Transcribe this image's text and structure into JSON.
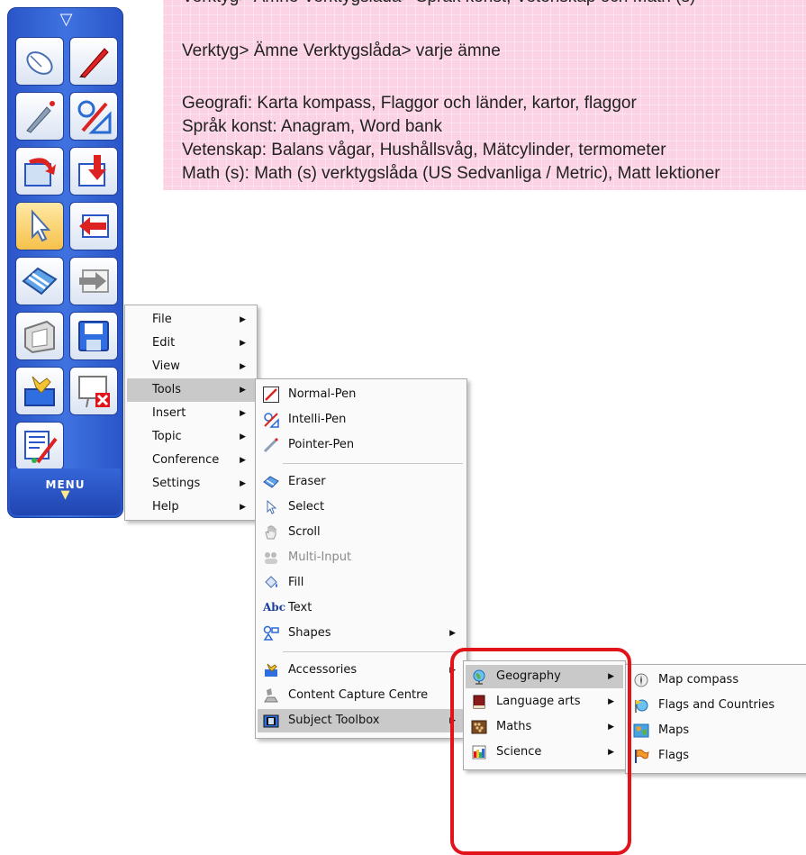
{
  "note": {
    "lines": [
      "Verktyg> Ämne Verktygslåda> Språk konst, Vetenskap och Math (s)",
      "Verktyg> Ämne Verktygslåda> varje ämne",
      "Geografi: Karta kompass, Flaggor och länder, kartor, flaggor",
      "Språk konst: Anagram, Word bank",
      "Vetenskap: Balans vågar, Hushållsvåg, Mätcylinder, termometer",
      "Math (s): Math (s) verktygslåda (US Sedvanliga / Metric), Matt lektioner"
    ]
  },
  "toolbar": {
    "collapse_arrow": "▽",
    "menu_label": "MENU",
    "menu_arrow": "▼"
  },
  "main_menu": {
    "items": [
      "File",
      "Edit",
      "View",
      "Tools",
      "Insert",
      "Topic",
      "Conference",
      "Settings",
      "Help"
    ],
    "selected": "Tools"
  },
  "tools_menu": {
    "items": [
      {
        "label": "Normal-Pen",
        "icon": "normal-pen-icon"
      },
      {
        "label": "Intelli-Pen",
        "icon": "intelli-pen-icon"
      },
      {
        "label": "Pointer-Pen",
        "icon": "pointer-pen-icon"
      },
      {
        "label": "Eraser",
        "icon": "eraser-icon"
      },
      {
        "label": "Select",
        "icon": "select-arrow-icon"
      },
      {
        "label": "Scroll",
        "icon": "hand-icon"
      },
      {
        "label": "Multi-Input",
        "icon": "multi-input-icon",
        "disabled": true
      },
      {
        "label": "Fill",
        "icon": "fill-bucket-icon"
      },
      {
        "label": "Text",
        "icon": "text-abc-icon",
        "icon_text": "Abc"
      },
      {
        "label": "Shapes",
        "icon": "shapes-icon"
      },
      {
        "label": "Accessories",
        "icon": "accessories-icon"
      },
      {
        "label": "Content Capture Centre",
        "icon": "capture-icon"
      },
      {
        "label": "Subject Toolbox",
        "icon": "toolbox-icon"
      }
    ],
    "selected": "Subject Toolbox"
  },
  "subject_menu": {
    "items": [
      {
        "label": "Geography",
        "icon": "globe-icon"
      },
      {
        "label": "Language arts",
        "icon": "book-icon"
      },
      {
        "label": "Maths",
        "icon": "abacus-icon"
      },
      {
        "label": "Science",
        "icon": "beaker-icon"
      }
    ],
    "selected": "Geography"
  },
  "geography_menu": {
    "items": [
      {
        "label": "Map compass",
        "icon": "compass-icon"
      },
      {
        "label": "Flags and Countries",
        "icon": "flag-globe-icon"
      },
      {
        "label": "Maps",
        "icon": "map-icon"
      },
      {
        "label": "Flags",
        "icon": "flag-icon"
      }
    ]
  },
  "colors": {
    "note_bg": "#fbd3e4",
    "toolbar_blue": "#2a55c8",
    "highlight": "#e2141b",
    "menu_selected": "#c9c9c9"
  }
}
